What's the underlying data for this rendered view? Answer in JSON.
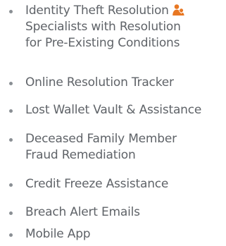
{
  "features": {
    "items": [
      {
        "lines": [
          "Identity Theft Resolution",
          "Specialists with Resolution",
          "for Pre-Existing Conditions"
        ],
        "icon": "person-icon",
        "icon_color": "#e87722"
      },
      {
        "lines": [
          "Online Resolution Tracker"
        ]
      },
      {
        "lines": [
          "Lost Wallet Vault & Assistance"
        ]
      },
      {
        "lines": [
          "Deceased Family Member",
          "Fraud Remediation"
        ]
      },
      {
        "lines": [
          "Credit Freeze Assistance"
        ]
      },
      {
        "lines": [
          "Breach Alert Emails"
        ]
      },
      {
        "lines": [
          "Mobile App"
        ]
      }
    ]
  }
}
